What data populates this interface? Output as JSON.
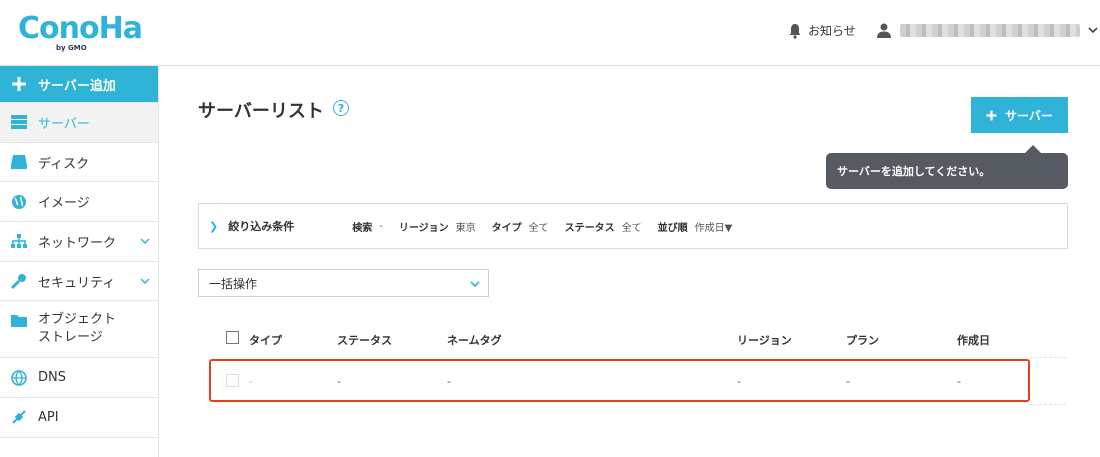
{
  "header": {
    "logo_text": "ConoHa",
    "logo_sub": "by GMO",
    "notice_label": "お知らせ"
  },
  "sidebar": {
    "items": [
      {
        "label": "サーバー追加",
        "icon": "plus-icon"
      },
      {
        "label": "サーバー",
        "icon": "server-icon"
      },
      {
        "label": "ディスク",
        "icon": "disk-icon"
      },
      {
        "label": "イメージ",
        "icon": "globe-icon"
      },
      {
        "label": "ネットワーク",
        "icon": "network-icon"
      },
      {
        "label": "セキュリティ",
        "icon": "key-icon"
      },
      {
        "label": "オブジェクト\nストレージ",
        "icon": "folder-icon"
      },
      {
        "label": "DNS",
        "icon": "dns-icon"
      },
      {
        "label": "API",
        "icon": "api-icon"
      }
    ]
  },
  "main": {
    "title": "サーバーリスト",
    "help": "?",
    "add_server_label": "サーバー",
    "tooltip": "サーバーを追加してください。",
    "filter": {
      "title": "絞り込み条件",
      "fields": [
        {
          "key": "検索",
          "value": "-"
        },
        {
          "key": "リージョン",
          "value": "東京"
        },
        {
          "key": "タイプ",
          "value": "全て"
        },
        {
          "key": "ステータス",
          "value": "全て"
        },
        {
          "key": "並び順",
          "value": "作成日▼"
        }
      ]
    },
    "bulk_action": "一括操作",
    "table": {
      "headers": [
        "タイプ",
        "ステータス",
        "ネームタグ",
        "リージョン",
        "プラン",
        "作成日"
      ],
      "row": [
        "-",
        "-",
        "-",
        "-",
        "-",
        "-"
      ]
    }
  },
  "colors": {
    "accent": "#2fb4d7",
    "highlight": "#e8401c",
    "tooltip_bg": "#555b60"
  }
}
